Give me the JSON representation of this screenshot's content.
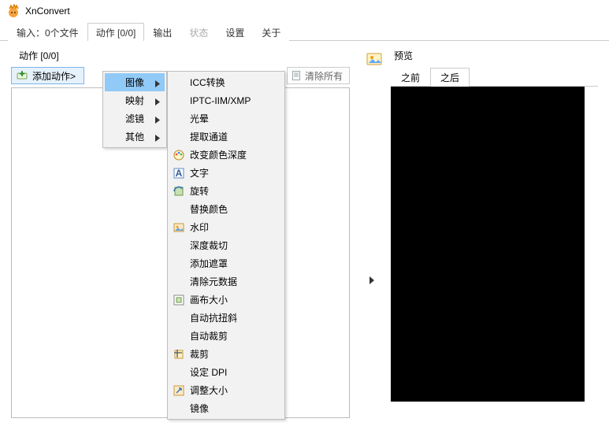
{
  "app": {
    "title": "XnConvert"
  },
  "tabs": {
    "input": "输入：0个文件",
    "actions": "动作 [0/0]",
    "output": "输出",
    "status": "状态",
    "settings": "设置",
    "about": "关于"
  },
  "actions": {
    "group_label": "动作 [0/0]",
    "add_button": "添加动作>",
    "clear_all": "清除所有"
  },
  "submenu1": {
    "image": "图像",
    "mapping": "映射",
    "filter": "滤镜",
    "other": "其他"
  },
  "submenu2": {
    "items": [
      {
        "label": "ICC转换",
        "icon": ""
      },
      {
        "label": "IPTC-IIM/XMP",
        "icon": ""
      },
      {
        "label": "光晕",
        "icon": ""
      },
      {
        "label": "提取通道",
        "icon": ""
      },
      {
        "label": "改变颜色深度",
        "icon": "palette"
      },
      {
        "label": "文字",
        "icon": "text"
      },
      {
        "label": "旋转",
        "icon": "rotate"
      },
      {
        "label": "替换颜色",
        "icon": ""
      },
      {
        "label": "水印",
        "icon": "watermark"
      },
      {
        "label": "深度裁切",
        "icon": ""
      },
      {
        "label": "添加遮罩",
        "icon": ""
      },
      {
        "label": "清除元数据",
        "icon": ""
      },
      {
        "label": "画布大小",
        "icon": "canvas"
      },
      {
        "label": "自动抗扭斜",
        "icon": ""
      },
      {
        "label": "自动裁剪",
        "icon": ""
      },
      {
        "label": "裁剪",
        "icon": "crop"
      },
      {
        "label": "设定 DPI",
        "icon": ""
      },
      {
        "label": "调整大小",
        "icon": "resize"
      },
      {
        "label": "镜像",
        "icon": ""
      }
    ]
  },
  "preview": {
    "title": "预览",
    "before": "之前",
    "after": "之后"
  }
}
